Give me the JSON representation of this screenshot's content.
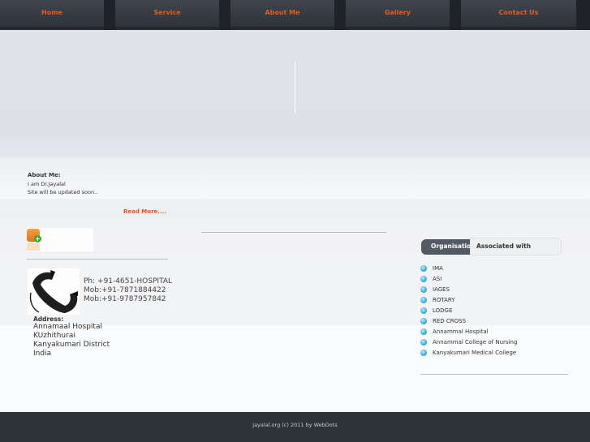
{
  "nav": {
    "items": [
      {
        "label": "Home"
      },
      {
        "label": "Service"
      },
      {
        "label": "About Me"
      },
      {
        "label": "Gallery"
      },
      {
        "label": "Contact Us"
      }
    ]
  },
  "about": {
    "title": "About Me:",
    "lines": [
      "I am Dr.Jayalal",
      "Site will be updated soon.."
    ],
    "read_more": "Read More...."
  },
  "contact": {
    "phone": "Ph: +91-4651-HOSPITAL",
    "mobile1": "Mob:+91-7871884422",
    "mobile2": "Mob:+91-9787957842",
    "address_title": "Address:",
    "address_lines": [
      "Annamaal Hospital",
      "KUzhithurai",
      "Kanyakumari District",
      "India"
    ]
  },
  "tabs": {
    "organisation": "Organisations",
    "associated": "Associated with"
  },
  "organisations": [
    "IMA",
    "ASI",
    "IAGES",
    "ROTARY",
    "LODGE",
    "RED CROSS",
    "Annammal Hospital",
    "Annammal College of Nursing",
    "Kanyakumari Medical College"
  ],
  "footer": {
    "text": "jayalal.org (c) 2011 by WebDots"
  },
  "colors": {
    "accent": "#e0561a",
    "nav_bg": "#2e333a",
    "bullet": "#3aaedc"
  }
}
